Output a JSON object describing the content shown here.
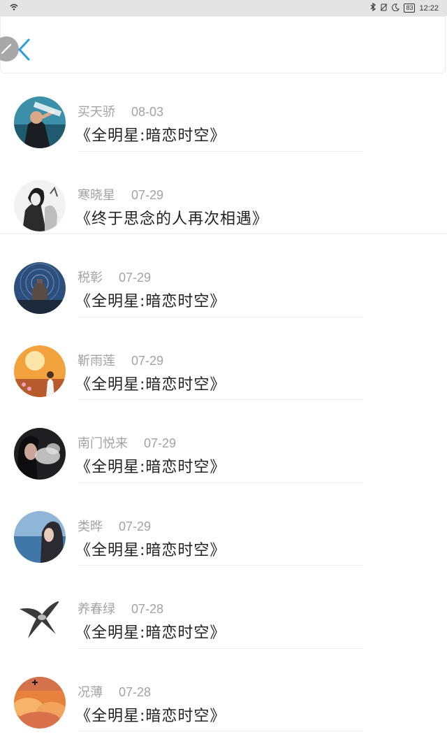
{
  "status_bar": {
    "time": "12:22",
    "battery": "83"
  },
  "header": {
    "back_icon": "chevron-left-icon",
    "edit_icon": "pencil-icon",
    "accent": "#2a9fe0"
  },
  "items": [
    {
      "name": "买天骄",
      "date": "08-03",
      "title": "《全明星:暗恋时空》",
      "avatar": "avatar-photo"
    },
    {
      "name": "寒晓星",
      "date": "07-29",
      "title": "《终于思念的人再次相遇》",
      "avatar": "avatar-sketch"
    },
    {
      "name": "税彰",
      "date": "07-29",
      "title": "《全明星:暗恋时空》",
      "avatar": "avatar-night-sky"
    },
    {
      "name": "靳雨莲",
      "date": "07-29",
      "title": "《全明星:暗恋时空》",
      "avatar": "avatar-sunset"
    },
    {
      "name": "南门悦来",
      "date": "07-29",
      "title": "《全明星:暗恋时空》",
      "avatar": "avatar-smoke"
    },
    {
      "name": "类晔",
      "date": "07-29",
      "title": "《全明星:暗恋时空》",
      "avatar": "avatar-sea"
    },
    {
      "name": "养春绿",
      "date": "07-28",
      "title": "《全明星:暗恋时空》",
      "avatar": "avatar-swallow"
    },
    {
      "name": "况薄",
      "date": "07-28",
      "title": "《全明星:暗恋时空》",
      "avatar": "avatar-clouds"
    }
  ]
}
